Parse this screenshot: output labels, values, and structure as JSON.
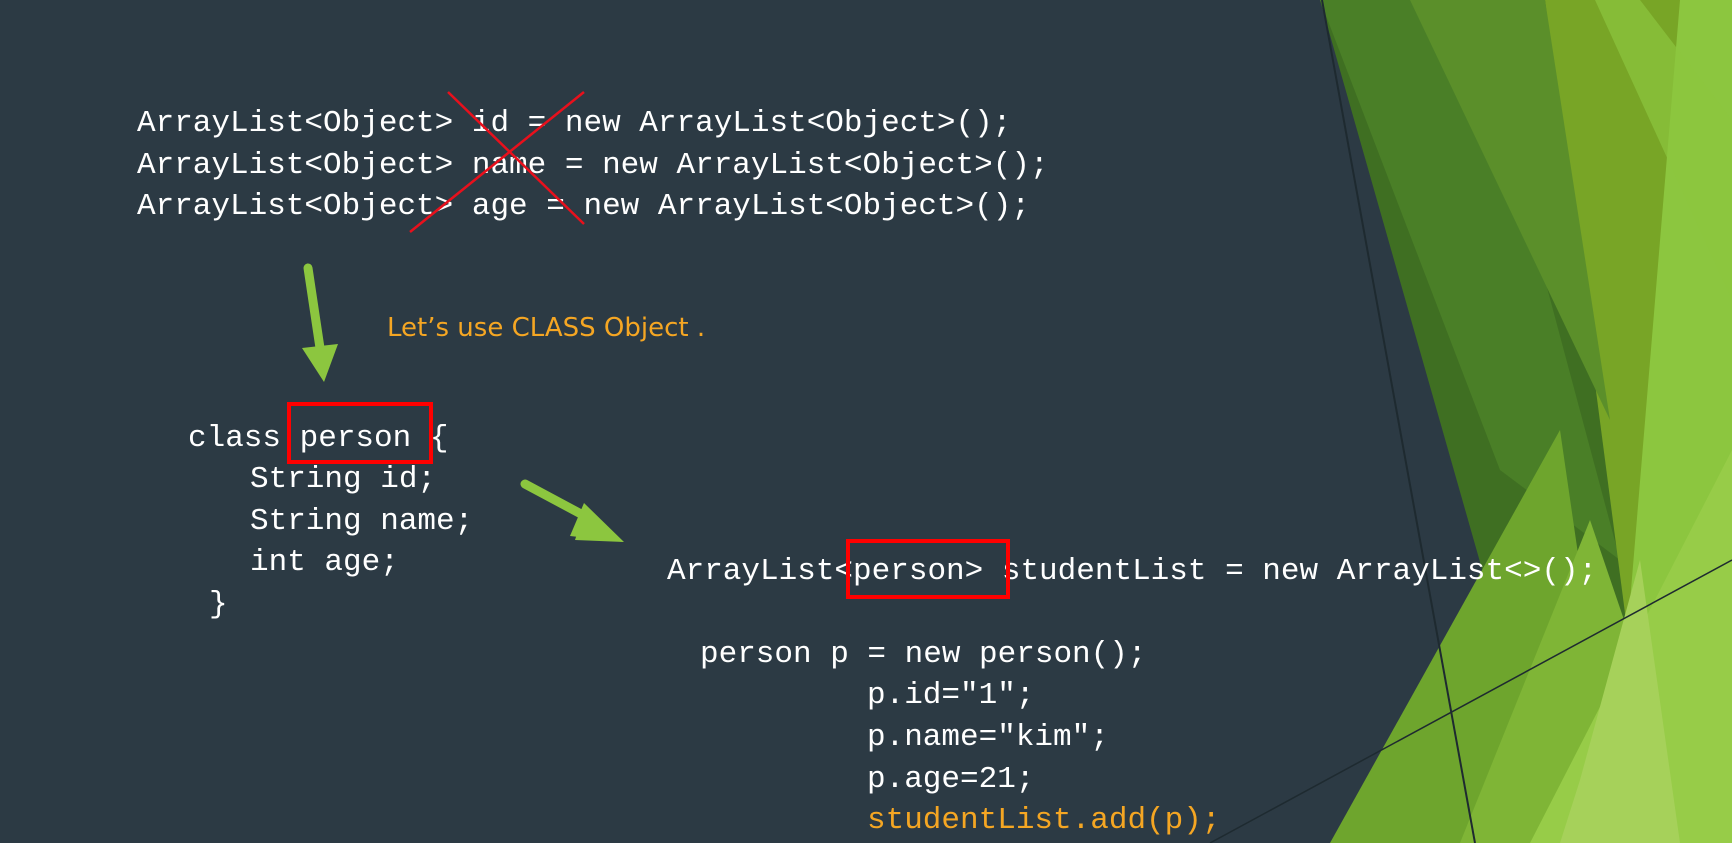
{
  "slide": {
    "background": "#2c3a44",
    "accent_colors": [
      "#4a7f27",
      "#78a526",
      "#8cc63f",
      "#a6d15a"
    ]
  },
  "top_code": {
    "line1": "ArrayList<Object> id = new ArrayList<Object>();",
    "line2": "ArrayList<Object> name = new ArrayList<Object>();",
    "line3": "ArrayList<Object> age = new ArrayList<Object>();"
  },
  "caption": "Let’s use CLASS Object .",
  "class_code": {
    "line1": "class person {",
    "line2": "String id;",
    "line3": "String name;",
    "line4": "int age;",
    "line5": "}"
  },
  "list_code": {
    "declaration": "ArrayList<person> studentList = new ArrayList<>();",
    "line1": "person p = new person();",
    "line2": "p.id=\"1\";",
    "line3": "p.name=\"kim\";",
    "line4": "p.age=21;",
    "line5": "studentList.add(p);"
  },
  "icons": {
    "cross_out": "red-x-mark",
    "arrow_down": "green-arrow-down",
    "arrow_right": "green-arrow-down-right"
  }
}
